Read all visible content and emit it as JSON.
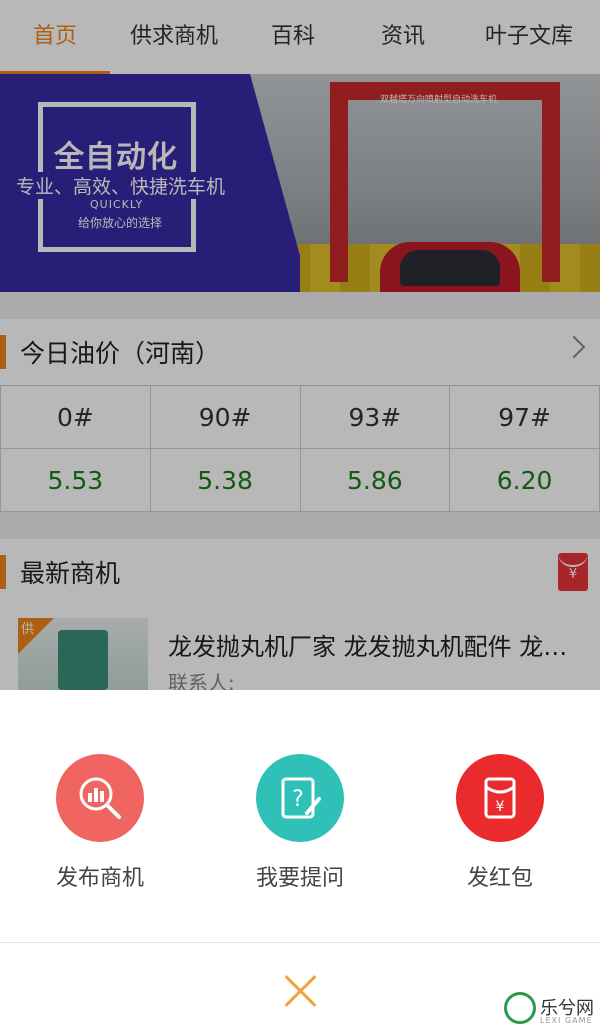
{
  "tabs": [
    {
      "label": "首页",
      "active": true
    },
    {
      "label": "供求商机"
    },
    {
      "label": "百科"
    },
    {
      "label": "资讯"
    },
    {
      "label": "叶子文库"
    }
  ],
  "banner": {
    "title": "全自动化",
    "subtitle": "专业、高效、快捷洗车机",
    "en": "QUICKLY",
    "tagline": "给你放心的选择",
    "wash_sign": "双越塔万向喷射型自动洗车机",
    "slide_count": 2,
    "active_slide": 2
  },
  "oil_price": {
    "section_title": "今日油价（河南）",
    "grades": [
      "0#",
      "90#",
      "93#",
      "97#"
    ],
    "prices": [
      "5.53",
      "5.38",
      "5.86",
      "6.20"
    ]
  },
  "opportunities": {
    "section_title": "最新商机",
    "hongbao_symbol": "¥",
    "items": [
      {
        "badge": "供",
        "title": "龙发抛丸机厂家 龙发抛丸机配件 龙…",
        "contact_label": "联系人:"
      }
    ]
  },
  "sheet": {
    "actions": [
      {
        "label": "发布商机",
        "icon": "magnifier-chart-icon",
        "color": "#f06560"
      },
      {
        "label": "我要提问",
        "icon": "question-edit-icon",
        "color": "#2fc1b8"
      },
      {
        "label": "发红包",
        "icon": "red-envelope-icon",
        "color": "#ea2b2e"
      }
    ]
  },
  "watermark": {
    "text": "乐兮网",
    "sub": "LEXI GAME"
  },
  "colors": {
    "accent": "#f08519",
    "price_green": "#1b7f1b"
  }
}
